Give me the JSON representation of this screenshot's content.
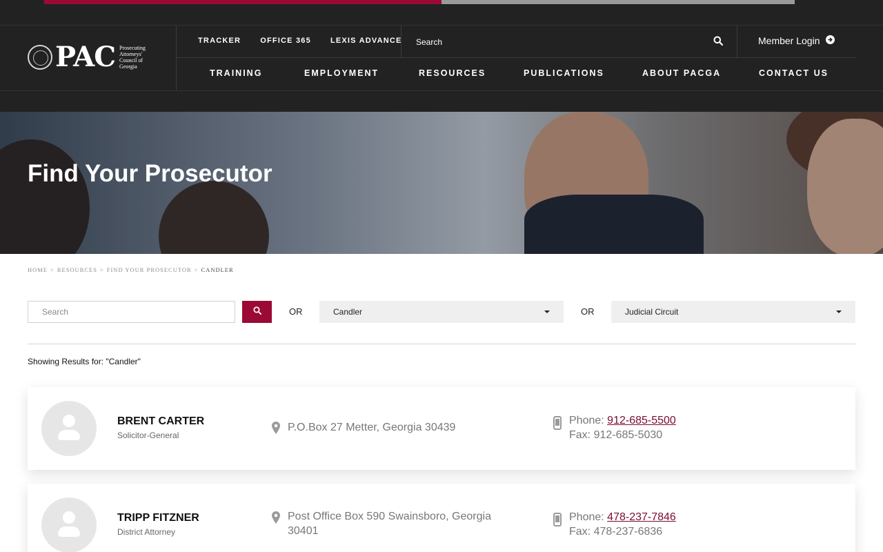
{
  "top_progress": {
    "fraction": 0.529,
    "fill_color": "#9b0a35",
    "track_color": "#9a9a9a"
  },
  "logo": {
    "text": "PAC",
    "subtitle": "Prosecuting Attorneys' Council of Georgia",
    "icon": "georgia-seal-icon"
  },
  "utility_links": [
    "TRACKER",
    "OFFICE 365",
    "LEXIS ADVANCE"
  ],
  "search": {
    "label": "Search",
    "icon": "search-icon"
  },
  "member_login": {
    "label": "Member Login",
    "icon": "arrow-circle-right-icon"
  },
  "main_nav": [
    "TRAINING",
    "EMPLOYMENT",
    "RESOURCES",
    "PUBLICATIONS",
    "ABOUT PACGA",
    "CONTACT US"
  ],
  "hero": {
    "title": "Find Your Prosecutor"
  },
  "breadcrumb": [
    "HOME",
    "RESOURCES",
    "FIND YOUR PROSECUTOR",
    "CANDLER"
  ],
  "filters": {
    "search_placeholder": "Search",
    "or_label": "OR",
    "county_selected": "Candler",
    "circuit_selected": "Judicial Circuit"
  },
  "showing_results": "Showing Results for: \"Candler\"",
  "results": [
    {
      "name": "BRENT CARTER",
      "role": "Solicitor-General",
      "address": "P.O.Box 27 Metter, Georgia 30439",
      "phone_label": "Phone:",
      "phone": "912-685-5500",
      "fax": "Fax: 912-685-5030"
    },
    {
      "name": "TRIPP FITZNER",
      "role": "District Attorney",
      "address": "Post Office Box 590 Swainsboro, Georgia 30401",
      "phone_label": "Phone:",
      "phone": "478-237-7846",
      "fax": "Fax: 478-237-6836"
    }
  ],
  "colors": {
    "accent": "#9b0a35",
    "header_bg": "#222222",
    "link": "#7a0b2e"
  }
}
